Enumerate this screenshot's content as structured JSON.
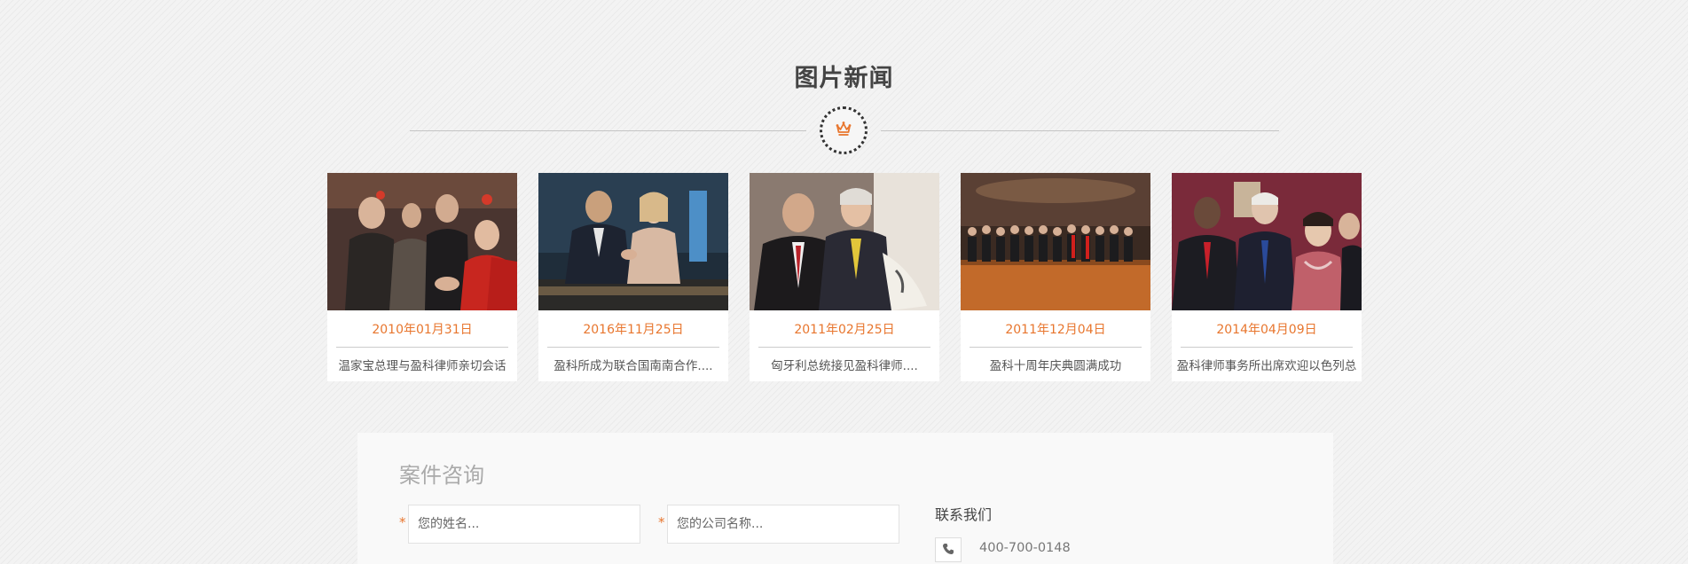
{
  "section": {
    "title": "图片新闻"
  },
  "news": [
    {
      "date": "2010年01月31日",
      "caption": "温家宝总理与盈科律师亲切会话"
    },
    {
      "date": "2016年11月25日",
      "caption": "盈科所成为联合国南南合作...."
    },
    {
      "date": "2011年02月25日",
      "caption": "匈牙利总统接见盈科律师...."
    },
    {
      "date": "2011年12月04日",
      "caption": "盈科十周年庆典圆满成功"
    },
    {
      "date": "2014年04月09日",
      "caption": "盈科律师事务所出席欢迎以色列总"
    }
  ],
  "consult": {
    "heading": "案件咨询",
    "required_mark": "*",
    "name_placeholder": "您的姓名...",
    "company_placeholder": "您的公司名称...",
    "contact_title": "联系我们",
    "phone": "400-700-0148"
  },
  "colors": {
    "accent": "#e8762e",
    "text": "#555555"
  },
  "icons": [
    "crown-icon",
    "phone-icon"
  ]
}
